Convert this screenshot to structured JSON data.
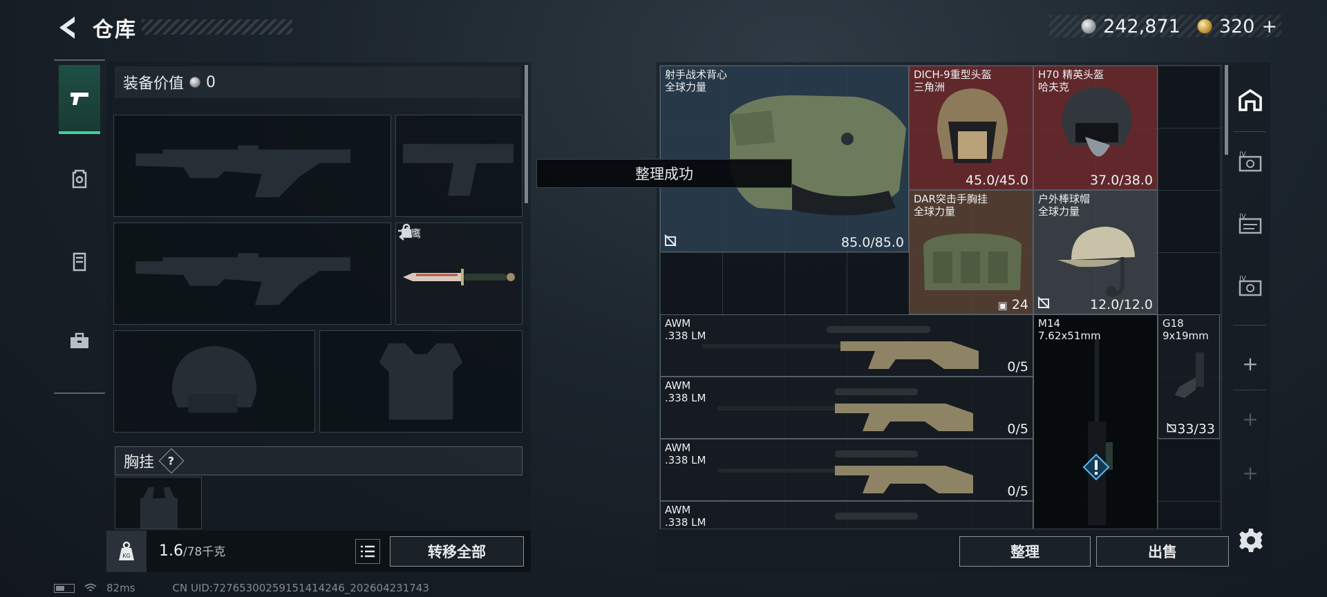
{
  "header": {
    "title": "仓库",
    "currency": {
      "silver": "242,871",
      "gold": "320",
      "plus": "+"
    }
  },
  "loadout": {
    "equipment_value_label": "装备价值",
    "equipment_value": "0",
    "knife_name": "黑鹰",
    "chest_rig_label": "胸挂",
    "chest_rig_help": "?",
    "weight_value": "1.6",
    "weight_max": "/78千克",
    "transfer_all_label": "转移全部"
  },
  "toast": "整理成功",
  "storage": {
    "items": [
      {
        "name": "射手战术背心",
        "sub": "全球力量",
        "durability": "85.0/85.0",
        "color": "blue"
      },
      {
        "name": "DICH-9重型头盔",
        "sub": "三角洲",
        "durability": "45.0/45.0",
        "color": "red"
      },
      {
        "name": "H70 精英头盔",
        "sub": "哈夫克",
        "durability": "37.0/38.0",
        "color": "red"
      },
      {
        "name": "DAR突击手胸挂",
        "sub": "全球力量",
        "stat": "24",
        "color": "brown"
      },
      {
        "name": "户外棒球帽",
        "sub": "全球力量",
        "durability": "12.0/12.0",
        "color": "gray"
      },
      {
        "name": "AWM",
        "sub": ".338 LM",
        "ammo": "0/5",
        "color": "dark"
      },
      {
        "name": "AWM",
        "sub": ".338 LM",
        "ammo": "0/5",
        "color": "dark"
      },
      {
        "name": "AWM",
        "sub": ".338 LM",
        "ammo": "0/5",
        "color": "dark"
      },
      {
        "name": "AWM",
        "sub": ".338 LM",
        "ammo": "",
        "color": "dark"
      },
      {
        "name": "M14",
        "sub": "7.62x51mm",
        "color": "black"
      },
      {
        "name": "G18",
        "sub": "9x19mm",
        "ammo": "33/33",
        "color": "dark"
      }
    ],
    "sort_label": "整理",
    "sell_label": "出售"
  },
  "status": {
    "ping": "82ms",
    "uid": "CN UID:727653002591514142​46_202604231743"
  },
  "colors": {
    "accent_green": "#40d39a",
    "rarity_blue": "#2c3e50",
    "rarity_red": "#702c2e",
    "rarity_brown": "#5a4234",
    "rarity_gray": "#3e444a"
  },
  "icons": [
    "back-arrow-icon",
    "silver-coin-icon",
    "gold-coin-icon",
    "pistol-icon",
    "backpack-icon",
    "vest-icon",
    "toolbox-icon",
    "swap-icon",
    "lock-icon",
    "weight-icon",
    "list-icon",
    "warehouse-icon",
    "gear-icon",
    "alert-icon"
  ]
}
